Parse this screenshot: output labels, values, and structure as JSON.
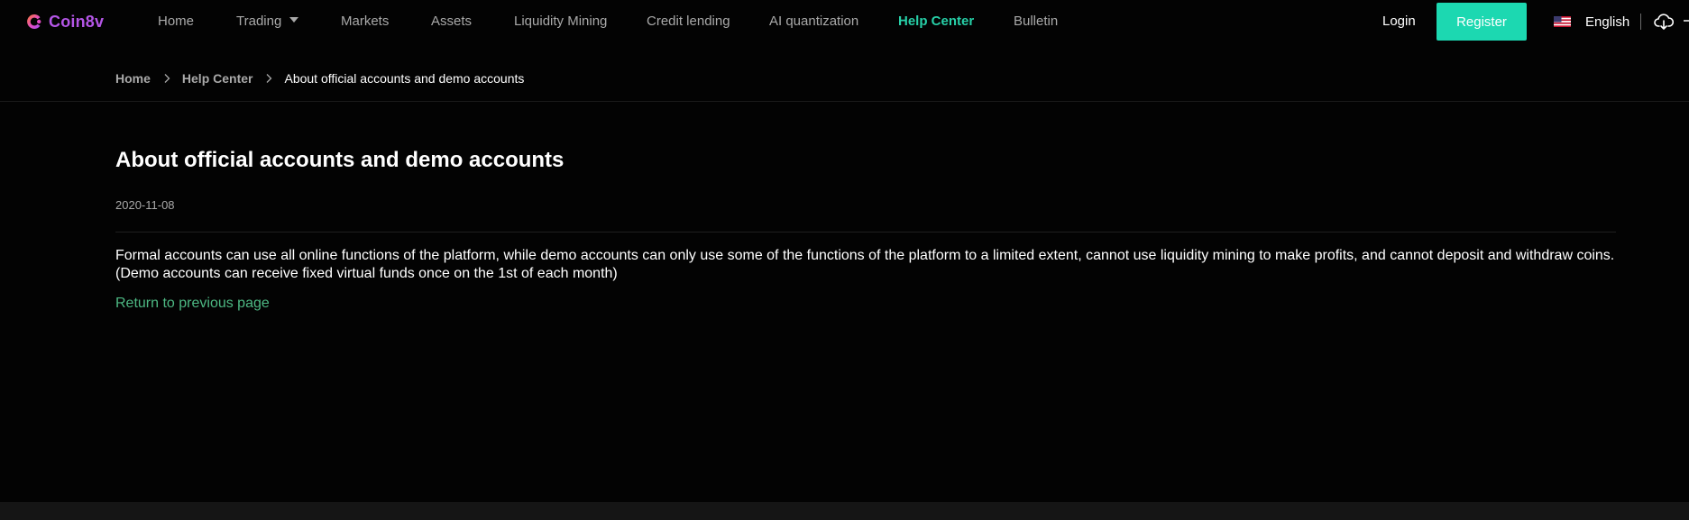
{
  "brand": {
    "name": "Coin8v",
    "logo_icon": "coin8v-logo-icon",
    "accent": "#b456e6"
  },
  "nav": {
    "items": [
      {
        "label": "Home"
      },
      {
        "label": "Trading",
        "has_dropdown": true
      },
      {
        "label": "Markets"
      },
      {
        "label": "Assets"
      },
      {
        "label": "Liquidity Mining"
      },
      {
        "label": "Credit lending"
      },
      {
        "label": "AI quantization"
      },
      {
        "label": "Help Center",
        "active": true
      },
      {
        "label": "Bulletin"
      }
    ],
    "active_color": "#27d0a8"
  },
  "auth": {
    "login_label": "Login",
    "register_label": "Register",
    "register_color": "#1cd8b1"
  },
  "language": {
    "label": "English",
    "flag_icon": "us-flag-icon"
  },
  "download_icon": "cloud-download-icon",
  "breadcrumb": {
    "home": "Home",
    "section": "Help Center",
    "current": "About official accounts and demo accounts"
  },
  "article": {
    "title": "About official accounts and demo accounts",
    "date": "2020-11-08",
    "body": "Formal accounts can use all online functions of the platform, while demo accounts can only use some of the functions of the platform to a limited extent, cannot use liquidity mining to make profits, and cannot deposit and withdraw coins. (Demo accounts can receive fixed virtual funds once on the 1st of each month)",
    "return_label": "Return to previous page",
    "link_color": "#4db883"
  }
}
